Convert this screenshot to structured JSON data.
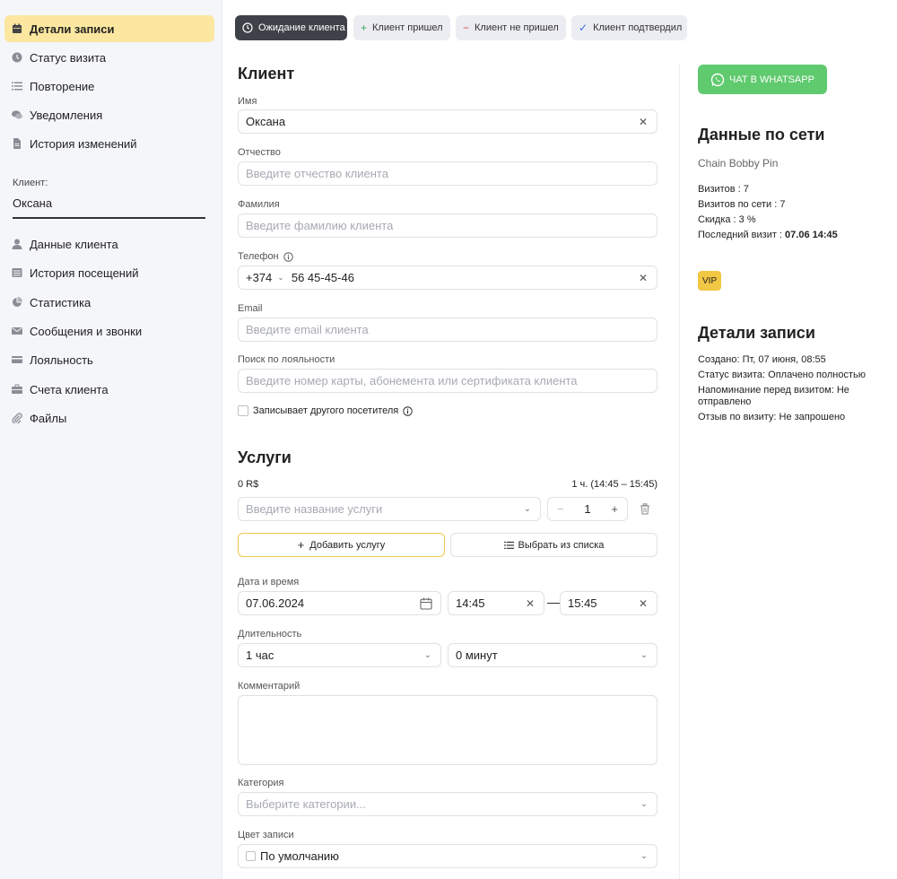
{
  "sidebar": {
    "items_top": [
      {
        "label": "Детали записи",
        "icon": "calendar-icon",
        "active": true
      },
      {
        "label": "Статус визита",
        "icon": "clock-icon"
      },
      {
        "label": "Повторение",
        "icon": "list-icon"
      },
      {
        "label": "Уведомления",
        "icon": "chat-icon"
      },
      {
        "label": "История изменений",
        "icon": "document-icon"
      }
    ],
    "client_label": "Клиент:",
    "client_name": "Оксана",
    "items_bottom": [
      {
        "label": "Данные клиента",
        "icon": "user-icon"
      },
      {
        "label": "История посещений",
        "icon": "history-icon"
      },
      {
        "label": "Статистика",
        "icon": "pie-chart-icon"
      },
      {
        "label": "Сообщения и звонки",
        "icon": "envelope-icon"
      },
      {
        "label": "Лояльность",
        "icon": "card-icon"
      },
      {
        "label": "Счета клиента",
        "icon": "briefcase-icon"
      },
      {
        "label": "Файлы",
        "icon": "paperclip-icon"
      }
    ]
  },
  "status_bar": [
    {
      "label": "Ожидание клиента",
      "icon": "clock-icon",
      "selected": true
    },
    {
      "label": "Клиент пришел",
      "icon": "plus-icon",
      "color": "#3aa757"
    },
    {
      "label": "Клиент не пришел",
      "icon": "minus-icon",
      "color": "#d9534f"
    },
    {
      "label": "Клиент подтвердил",
      "icon": "check-icon",
      "color": "#3f6ad8"
    }
  ],
  "client": {
    "title": "Клиент",
    "name_label": "Имя",
    "name_value": "Оксана",
    "patronymic_label": "Отчество",
    "patronymic_placeholder": "Введите отчество клиента",
    "surname_label": "Фамилия",
    "surname_placeholder": "Введите фамилию клиента",
    "phone_label": "Телефон",
    "phone_code": "+374",
    "phone_value": "56 45-45-46",
    "email_label": "Email",
    "email_placeholder": "Введите email клиента",
    "loyalty_label": "Поиск по лояльности",
    "loyalty_placeholder": "Введите номер карты, абонемента или сертификата клиента",
    "other_visitor_label": "Записывает другого посетителя"
  },
  "services": {
    "title": "Услуги",
    "price": "0 R$",
    "duration_summary": "1 ч. (14:45 – 15:45)",
    "service_placeholder": "Введите название услуги",
    "quantity": "1",
    "add_service_label": "Добавить услугу",
    "choose_from_list_label": "Выбрать из списка"
  },
  "datetime": {
    "label": "Дата и время",
    "date": "07.06.2024",
    "start": "14:45",
    "dash": "—",
    "end": "15:45"
  },
  "duration": {
    "label": "Длительность",
    "hours": "1 час",
    "minutes": "0 минут"
  },
  "comment_label": "Комментарий",
  "category": {
    "label": "Категория",
    "placeholder": "Выберите категории..."
  },
  "record_color": {
    "label": "Цвет записи",
    "value": "По умолчанию"
  },
  "right_panel": {
    "whatsapp_label": "ЧАТ В WHATSAPP",
    "network_title": "Данные по сети",
    "network_name": "Chain Bobby Pin",
    "visits": "Визитов : 7",
    "network_visits": "Визитов по сети : 7",
    "discount": "Скидка : 3 %",
    "last_visit_label": "Последний визит : ",
    "last_visit_value": "07.06 14:45",
    "vip_badge": "VIP",
    "details_title": "Детали записи",
    "created": "Создано: Пт, 07 июня, 08:55",
    "visit_status": "Статус визита: Оплачено полностью",
    "reminder": "Напоминание перед визитом: Не отправлено",
    "review": "Отзыв по визиту: Не запрошено"
  },
  "colors": {
    "accent_yellow": "#fbe7a0",
    "whatsapp_green": "#5fca6e",
    "vip_yellow": "#f2c744",
    "dark_button": "#3f4148"
  }
}
